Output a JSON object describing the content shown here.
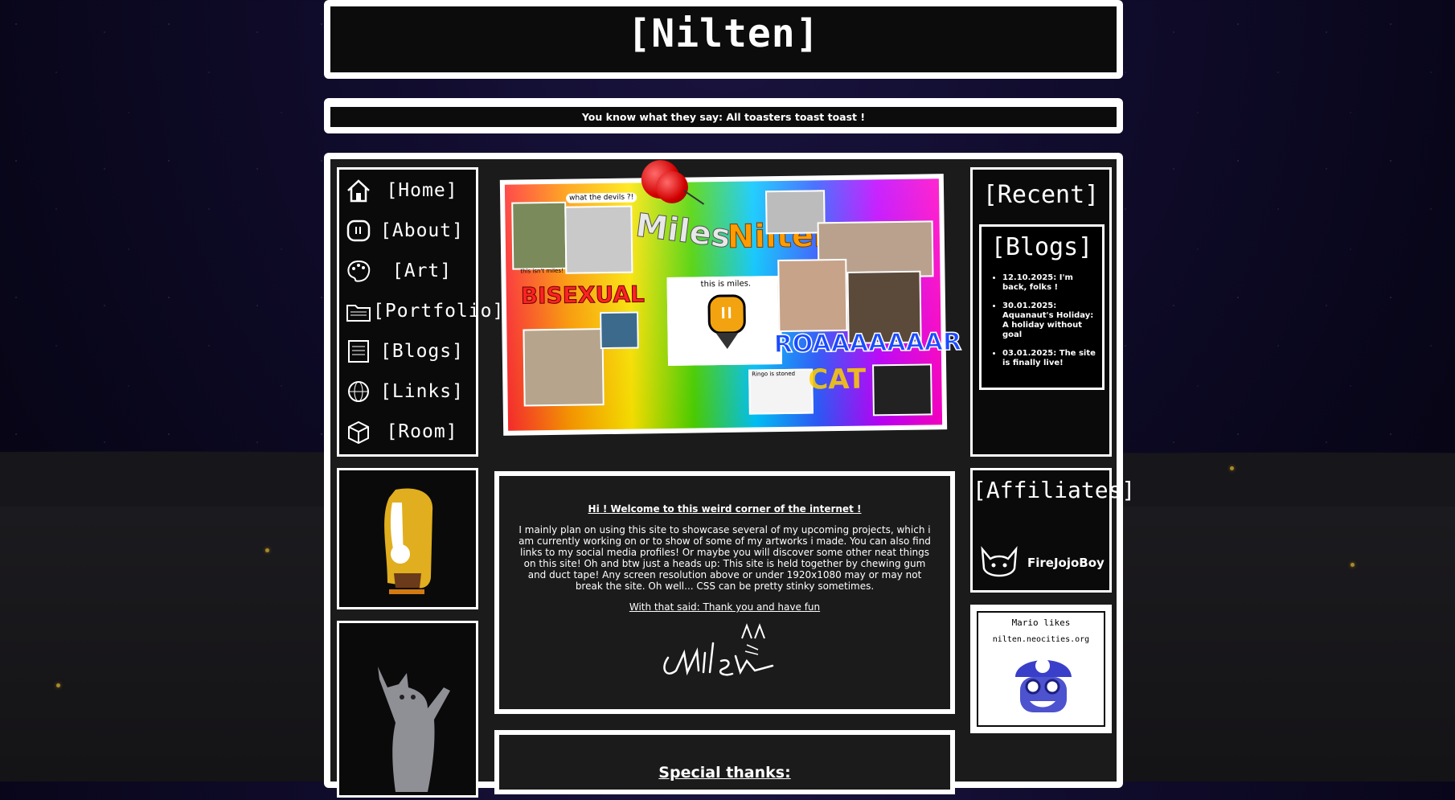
{
  "site": {
    "logo": "[Nilten]",
    "tagline": "You know what they say: All toasters toast toast !"
  },
  "nav": {
    "items": [
      {
        "label": "[Home]",
        "icon": "house-icon"
      },
      {
        "label": "[About]",
        "icon": "toaster-icon"
      },
      {
        "label": "[Art]",
        "icon": "palette-icon"
      },
      {
        "label": "[Portfolio]",
        "icon": "folder-icon"
      },
      {
        "label": "[Blogs]",
        "icon": "notebook-icon"
      },
      {
        "label": "[Links]",
        "icon": "globe-icon"
      },
      {
        "label": "[Room]",
        "icon": "box-icon"
      }
    ]
  },
  "collage": {
    "logo_miles": "Miles",
    "logo_nilten": "Nilten",
    "bisexual": "BISEXUAL",
    "roar": "ROAAAAAAAR",
    "cat": "CAT",
    "devils_bubble": "what the devils ?!",
    "this_is_miles": "this is miles.",
    "this_isnt_miles": "this isn't miles!",
    "ringo": "Ringo is stoned"
  },
  "recent": {
    "title": "[Recent]",
    "blogs_title": "[Blogs]",
    "posts": [
      "12.10.2025: I'm back, folks !",
      "30.01.2025: Aquanaut's Holiday: A holiday without goal",
      "03.01.2025: The site is finally live!"
    ]
  },
  "welcome": {
    "title": "Hi ! Welcome to this weird corner of the internet !",
    "body": "I mainly plan on using this site to showcase several of my upcoming projects, which i am currently working on or to show of some of my artworks i made. You can also find links to my social media profiles! Or maybe you will discover some other neat things on this site! Oh and btw just a heads up: This site is held together by chewing gum and duct tape! Any screen resolution above or under 1920x1080 may or may not break the site. Oh well... CSS can be pretty stinky sometimes.",
    "closing": "With that said: Thank you and have fun"
  },
  "special_thanks": {
    "title": "Special thanks:"
  },
  "affiliates": {
    "title": "[Affiliates]",
    "items": [
      {
        "label": "FireJojoBoy",
        "icon": "cat-head-icon"
      }
    ]
  },
  "mario_badge": {
    "line1": "Mario likes",
    "line2": "nilten.neocities.org"
  },
  "colors": {
    "frame": "#ffffff",
    "panel": "#0c0c0c",
    "sky": "#0f0b2a",
    "avatar_hair": "#e0ae1e",
    "mario_blue": "#3a3fc9"
  }
}
